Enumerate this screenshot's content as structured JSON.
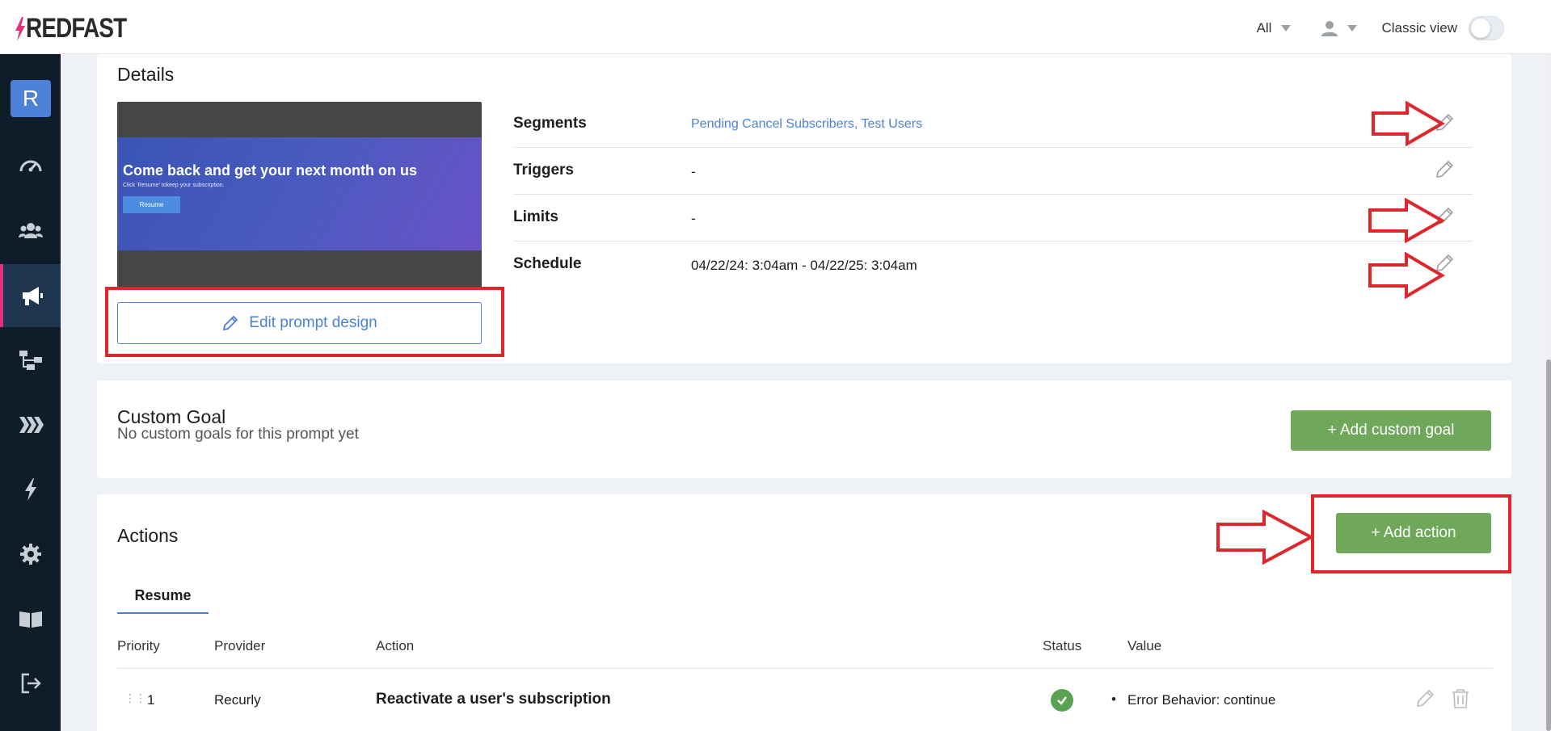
{
  "app": {
    "logo_text": "REDFAST",
    "filter_label": "All",
    "classic_view_label": "Classic view"
  },
  "sidebar": {
    "avatar_letter": "R",
    "items": [
      {
        "icon": "dashboard-icon"
      },
      {
        "icon": "users-icon"
      },
      {
        "icon": "megaphone-icon",
        "active": true
      },
      {
        "icon": "flow-icon"
      },
      {
        "icon": "chevrons-icon"
      },
      {
        "icon": "lightning-icon"
      },
      {
        "icon": "gear-icon"
      },
      {
        "icon": "book-icon"
      },
      {
        "icon": "logout-icon"
      }
    ]
  },
  "details": {
    "title": "Details",
    "preview": {
      "headline": "Come back and get your next month on us",
      "subtext": "Click 'Resume' tokeep your subscription.",
      "button": "Resume"
    },
    "edit_design_label": "Edit prompt design",
    "rows": [
      {
        "label": "Segments",
        "value": "Pending Cancel Subscribers, Test Users"
      },
      {
        "label": "Triggers",
        "value": "-"
      },
      {
        "label": "Limits",
        "value": "-"
      },
      {
        "label": "Schedule",
        "value": "04/22/24: 3:04am - 04/22/25: 3:04am"
      }
    ]
  },
  "custom_goal": {
    "title": "Custom Goal",
    "empty_text": "No custom goals for this prompt yet",
    "add_label": "+ Add custom goal"
  },
  "actions": {
    "title": "Actions",
    "add_label": "+ Add action",
    "tab": "Resume",
    "columns": [
      "Priority",
      "Provider",
      "Action",
      "Status",
      "Value"
    ],
    "rows": [
      {
        "priority": "1",
        "provider": "Recurly",
        "action": "Reactivate a user's subscription",
        "status": "success",
        "value": "Error Behavior: continue"
      }
    ]
  },
  "colors": {
    "brand": "#e0317a",
    "accent_blue": "#4b82d8",
    "green": "#6fa85b",
    "sidebar_bg": "#0f1d2b",
    "annotation_red": "#e0262d"
  }
}
